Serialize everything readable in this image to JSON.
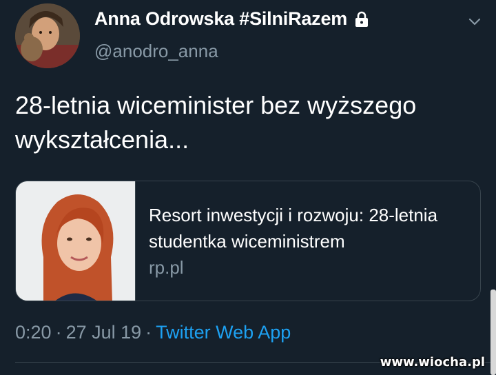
{
  "author": {
    "display_name": "Anna Odrowska #SilniRazem",
    "handle": "@anodro_anna",
    "protected_icon": "lock-icon"
  },
  "menu_icon": "chevron-down-icon",
  "tweet": {
    "text": "28-letnia wiceminister bez wyższego wykształcenia..."
  },
  "card": {
    "title": "Resort inwestycji i rozwoju: 28-letnia studentka wiceministrem",
    "domain": "rp.pl"
  },
  "meta": {
    "time": "0:20",
    "date": "27 Jul 19",
    "separator": "·",
    "source": "Twitter Web App"
  },
  "watermark": "www.wiocha.pl",
  "colors": {
    "background": "#15202b",
    "text": "#ffffff",
    "secondary_text": "#8899a6",
    "link": "#1da1f2",
    "border": "#38444d"
  }
}
